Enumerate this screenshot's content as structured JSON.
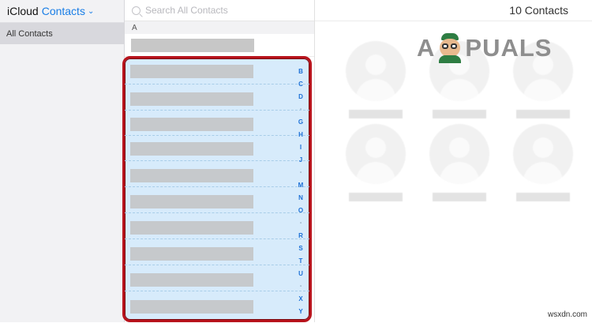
{
  "sidebar": {
    "brand": "iCloud",
    "app": "Contacts",
    "group": "All Contacts"
  },
  "list": {
    "search_placeholder": "Search All Contacts",
    "section_header": "A",
    "index_letters": [
      "B",
      "C",
      "D",
      "•",
      "G",
      "H",
      "I",
      "J",
      "•",
      "M",
      "N",
      "O",
      "•",
      "R",
      "S",
      "T",
      "U",
      "•",
      "X",
      "Y"
    ]
  },
  "detail": {
    "count_label": "10 Contacts"
  },
  "logo": {
    "text_left": "A",
    "text_right": "PUALS"
  },
  "watermark": "wsxdn.com",
  "colors": {
    "accent": "#1a7ee6",
    "selection_bg": "#d7ebfb",
    "highlight_border": "#b8131c"
  }
}
